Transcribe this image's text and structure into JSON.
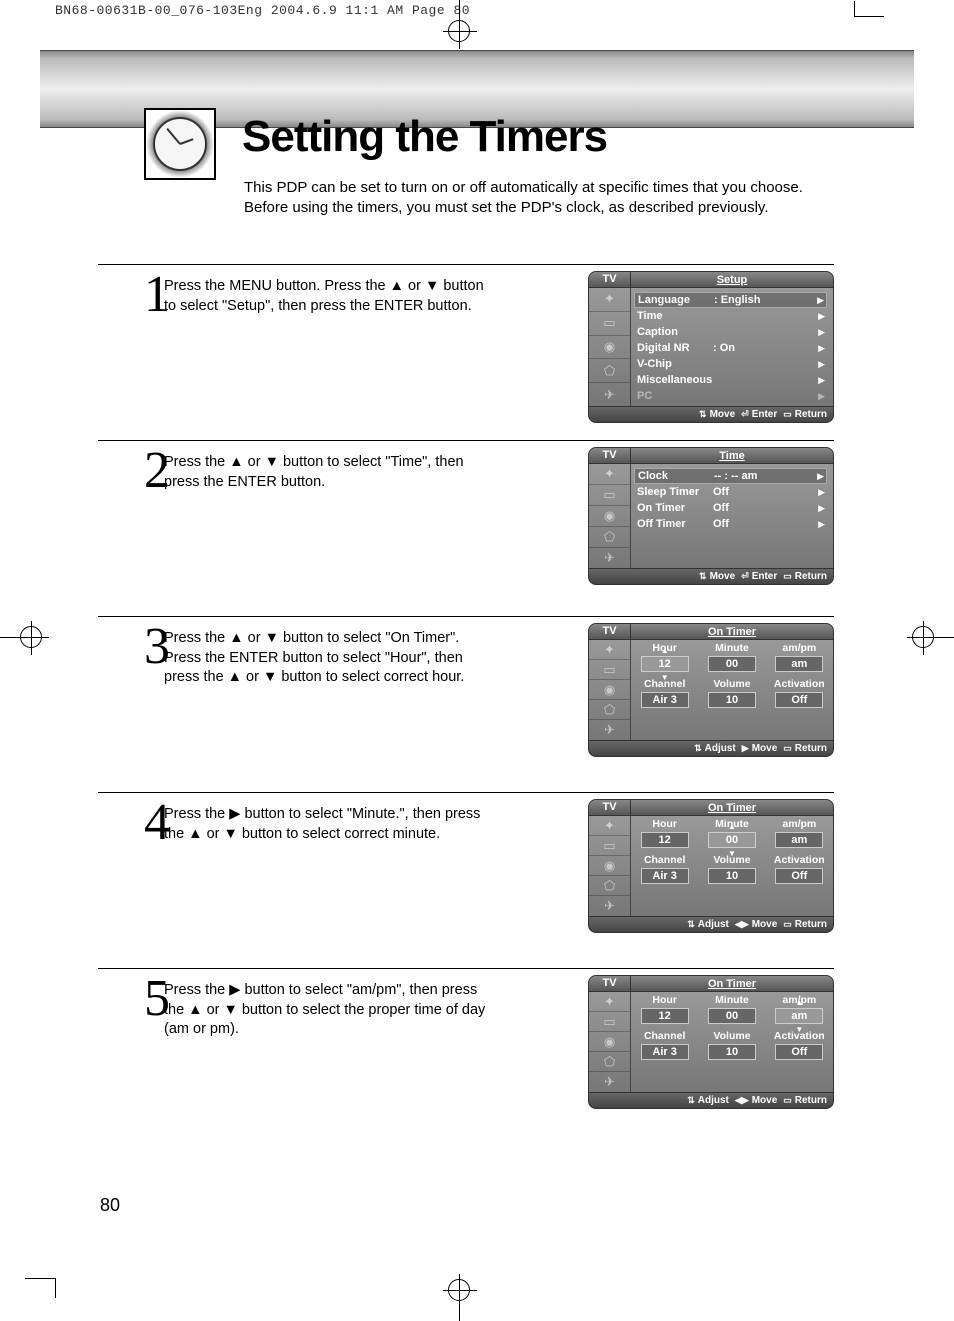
{
  "crop_header": "BN68-00631B-00_076-103Eng  2004.6.9  11:1 AM  Page 80",
  "page_title": "Setting the Timers",
  "page_intro": "This PDP can be set to turn on or off automatically at specific times that you choose. Before using the timers, you must set the PDP's clock, as described previously.",
  "page_number": "80",
  "steps": {
    "s1": {
      "num": "1",
      "text": "Press the MENU button. Press the ▲ or ▼ button to select \"Setup\", then press the ENTER button."
    },
    "s2": {
      "num": "2",
      "text": "Press the ▲ or ▼ button to select \"Time\", then press the ENTER button."
    },
    "s3": {
      "num": "3",
      "text": "Press the ▲ or ▼ button to select \"On Timer\". Press the ENTER button to select \"Hour\", then press the ▲ or ▼ button to select correct hour."
    },
    "s4": {
      "num": "4",
      "text": "Press the ▶ button to select \"Minute.\", then press the ▲ or ▼ button to select correct minute."
    },
    "s5": {
      "num": "5",
      "text": "Press the ▶ button to select \"am/pm\", then press the ▲ or ▼ button to select the proper time of day (am or pm)."
    }
  },
  "osd": {
    "tv": "TV",
    "setup": {
      "title": "Setup",
      "rows": {
        "language": {
          "lab": "Language",
          "val": ":  English"
        },
        "time": {
          "lab": "Time",
          "val": ""
        },
        "caption": {
          "lab": "Caption",
          "val": ""
        },
        "dnr": {
          "lab": "Digital NR",
          "val": ":  On"
        },
        "vchip": {
          "lab": "V-Chip",
          "val": ""
        },
        "misc": {
          "lab": "Miscellaneous",
          "val": ""
        },
        "pc": {
          "lab": "PC",
          "val": ""
        }
      }
    },
    "time": {
      "title": "Time",
      "rows": {
        "clock": {
          "lab": "Clock",
          "val": "-- : -- am"
        },
        "sleep": {
          "lab": "Sleep Timer",
          "val": "Off"
        },
        "ontmr": {
          "lab": "On Timer",
          "val": "Off"
        },
        "offtmr": {
          "lab": "Off Timer",
          "val": "Off"
        }
      }
    },
    "ontimer": {
      "title": "On Timer",
      "labels": {
        "hour": "Hour",
        "minute": "Minute",
        "ampm": "am/pm",
        "channel": "Channel",
        "volume": "Volume",
        "activation": "Activation"
      },
      "vals": {
        "hour": "12",
        "minute": "00",
        "ampm": "am",
        "channel": "Air   3",
        "volume": "10",
        "activation": "Off"
      }
    },
    "ftr": {
      "move": "Move",
      "enter": "Enter",
      "return": "Return",
      "adjust": "Adjust"
    }
  }
}
